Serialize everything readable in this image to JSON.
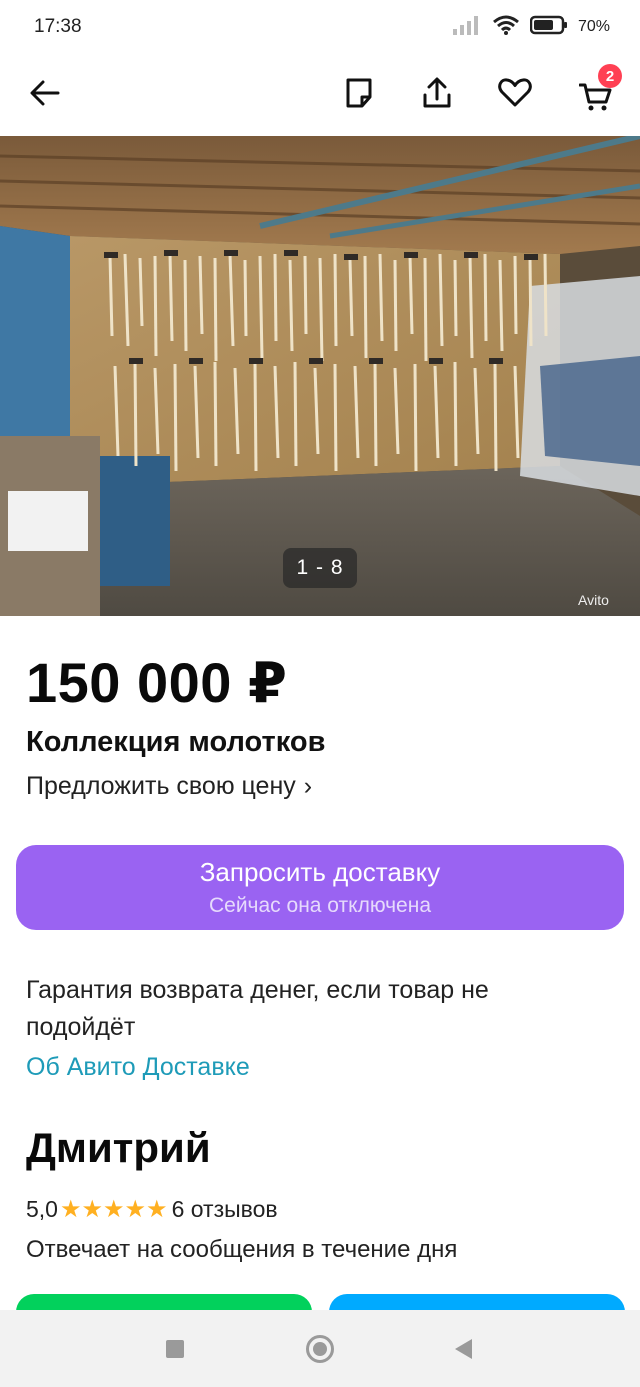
{
  "status_bar": {
    "time": "17:38",
    "battery": "70",
    "icons": [
      "signal-icon",
      "wifi-icon",
      "battery-icon"
    ]
  },
  "toolbar": {
    "icons": [
      "back-arrow-icon",
      "note-icon",
      "share-icon",
      "heart-icon",
      "cart-icon"
    ],
    "cart_badge": "2"
  },
  "listing": {
    "photo_counter": "1 - 8",
    "watermark": "Avito",
    "price": "150 000 ₽",
    "title": "Коллекция молотков",
    "offer_price": "Предложить свою цену",
    "offer_chevron": "›"
  },
  "delivery": {
    "title": "Запросить доставку",
    "subtitle": "Сейчас она отключена",
    "guarantee": "Гарантия возврата денег, если товар не подойдёт",
    "about_link": "Об Авито Доставке"
  },
  "seller": {
    "name": "Дмитрий",
    "rating": "5,0",
    "rating_stars": 5,
    "reviews": "6 отзывов",
    "reply_info": "Отвечает на сообщения в течение дня"
  },
  "colors": {
    "delivery_button": "#9a63f2",
    "link": "#1e9bb8",
    "star": "#ffb021",
    "badge": "#ff4053",
    "call_button": "#02d15c",
    "write_button": "#00aaff"
  },
  "navbar": {
    "icons": [
      "recents-square-icon",
      "home-circle-icon",
      "back-triangle-icon"
    ]
  }
}
